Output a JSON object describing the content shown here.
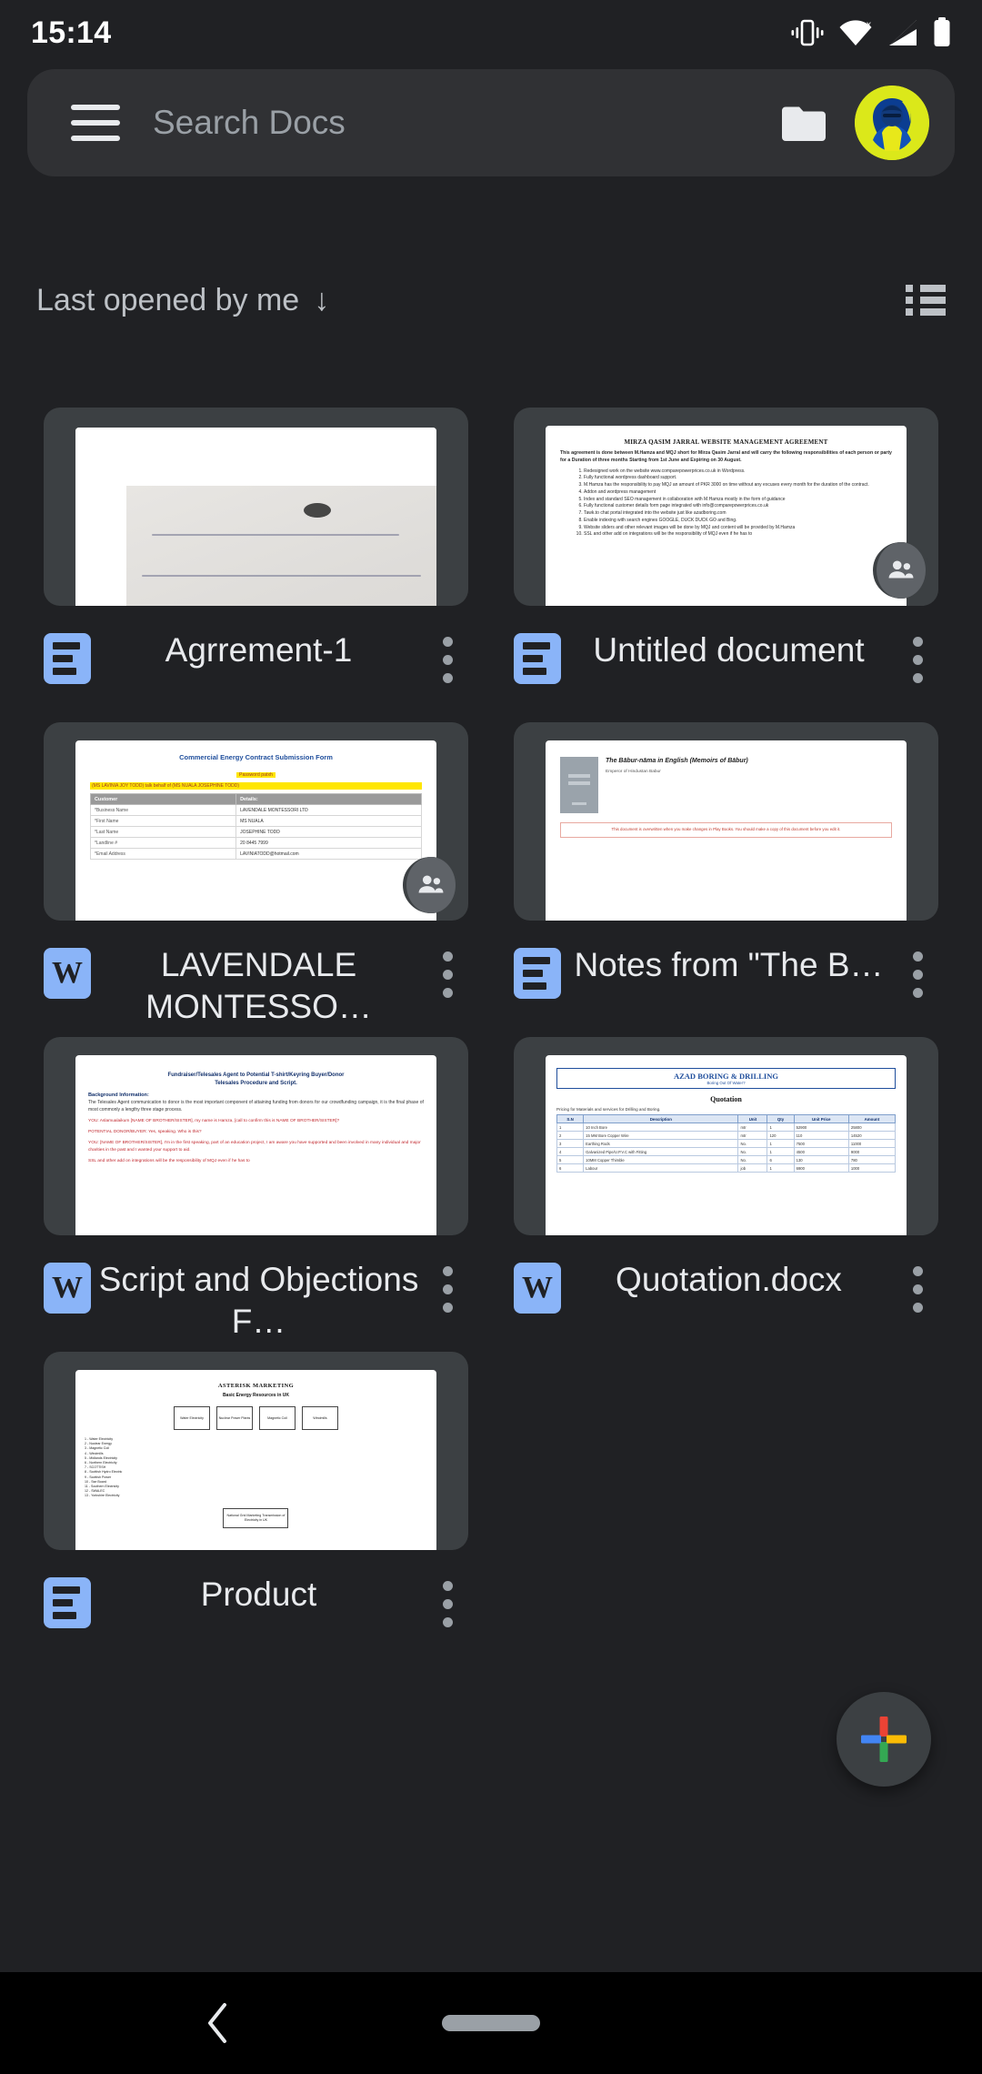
{
  "status_bar": {
    "time": "15:14",
    "icons": [
      "vibrate-icon",
      "wifi-icon",
      "signal-icon",
      "battery-icon"
    ]
  },
  "search": {
    "placeholder": "Search Docs",
    "value": "",
    "menu_icon": "hamburger-menu-icon",
    "folder_icon": "folder-icon",
    "avatar_label": "account-avatar"
  },
  "sort": {
    "label": "Last opened by me",
    "arrow": "↓",
    "view_toggle_icon": "list-view-icon"
  },
  "colors": {
    "background": "#202124",
    "surface": "#303134",
    "thumb_bg": "#3c4043",
    "docs_blue": "#8ab4f8",
    "text_primary": "#e8eaed",
    "text_secondary": "#9aa0a6"
  },
  "fab": {
    "label": "create-new-document",
    "icon": "google-plus-icon"
  },
  "nav": {
    "back_icon": "back-chevron-icon",
    "home_pill": "home-gesture-pill"
  },
  "documents": [
    {
      "title": "Agrrement-1",
      "type_icon": "google-docs-icon",
      "type": "docs",
      "shared": false,
      "thumbnail": {
        "kind": "handwriting-scan",
        "description": "Scanned handwritten Urdu letter on white page"
      }
    },
    {
      "title": "Untitled document",
      "type_icon": "google-docs-icon",
      "type": "docs",
      "shared": true,
      "thumbnail": {
        "kind": "text-document",
        "heading": "MIRZA QASIM JARRAL WEBSITE  MANAGEMENT AGREEMENT",
        "intro": "This agreement is done between M.Hamza and MQJ short for Mirza Qasim Jarral and will carry the following responsibilities of each person or party for a Duration of three months Starting from 1st June and Expiring on 30 August.",
        "items": [
          "Redesigned work on the website www.comparepowerprices.co.uk in Wordpress.",
          "Fully functional wordpress dashboard support.",
          "M.Hamza has the responsibility to pay MQJ an amount of PKR 3000 on time without any excuses every month for the duration of the contract.",
          "Addon and wordpress management",
          "Index and standard SEO management  in collaboration with M.Hamza mostly in the form of guidance",
          "Fully functional customer details form page integrated with info@comparepowerprices.co.uk",
          "Tawk.to chat portal integrated into the website just like azadboring.com",
          "Enable indexing with search engines GOOGLE, DUCK DUCK GO and Bing.",
          "Website sliders and other relevant images will be done by MQJ and content will be provided by M.Hamza",
          "SSL and other add on integrations will be the responsibility of MQJ even if he has to"
        ]
      }
    },
    {
      "title": "LAVENDALE MONTESSO…",
      "type_icon": "word-doc-icon",
      "type": "word",
      "shared": true,
      "thumbnail": {
        "kind": "form-table",
        "heading": "Commercial Energy Contract Submission Form",
        "highlight_1": "Password     patxh",
        "highlight_2": "(MS LAVINIA JOY TODD) talk behalf of (MS NUALA JOSEPHINE TODD)",
        "columns": [
          "Customer",
          "Details:"
        ],
        "rows": [
          [
            "*Business Name",
            "LAVENDALE MONTESSORI LTD"
          ],
          [
            "*First Name",
            "MS NUALA"
          ],
          [
            "*Last Name",
            "JOSEPHINE TODD"
          ],
          [
            "*Landline #",
            "20 8445 7999"
          ],
          [
            "*Email Address",
            "LAVINIATODD@hotmail.com"
          ]
        ]
      }
    },
    {
      "title": "Notes from \"The B…",
      "type_icon": "google-docs-icon",
      "type": "docs",
      "shared": false,
      "thumbnail": {
        "kind": "book-notes",
        "heading": "The Bābur-nāma in English (Memoirs of Bābur)",
        "subheading": "Emperor of Hindustan Babur",
        "warning": "This document is overwritten when you make changes in Play Books. You should make a copy of this document before you edit it."
      }
    },
    {
      "title": "Script and Objections F…",
      "type_icon": "word-doc-icon",
      "type": "word",
      "shared": false,
      "thumbnail": {
        "kind": "script-document",
        "heading_1": "Fundraiser/Telesales Agent to Potential T-shirt/Keyring Buyer/Donor",
        "heading_2": "Telesales Procedure and Script.",
        "section": "Background Information:",
        "body": "The Telesales Agent communication to donor is the most important component of attaining funding from donors for our crowdfunding campaign, it is the final phase of most commonly a lengthy three stage process.",
        "red_1": "YOU: Aslamualaikum [NAME OF BROTHER/SISTER], my name is Hamza, [call to confirm this is NAME OF BROTHER/SISTER]?",
        "red_2": "POTENTIAL DONOR/BUYER: Yes, speaking. Who is this?",
        "red_3": "YOU: [NAME OF BROTHER/SISTER], I'm in the first speaking, part of an education project, I am aware you have supported and been involved in many individual and major charities in the past and I wanted your support to aid.",
        "red_4": "SSL and other add on integrations will be the responsibility of MQJ even if he has to"
      }
    },
    {
      "title": "Quotation.docx",
      "type_icon": "word-doc-icon",
      "type": "word",
      "shared": false,
      "thumbnail": {
        "kind": "quotation-document",
        "company": "AZAD BORING & DRILLING",
        "tagline": "Boring Out Of Water?",
        "heading": "Quotation",
        "subtext": "Pricing for Materials and services for Drilling and Boring.",
        "columns": [
          "S.N",
          "Description",
          "Unit",
          "Qty",
          "Unit Price",
          "Amount"
        ],
        "rows": [
          [
            "1",
            "10 Inch Bore",
            "mtr",
            "1",
            "52900",
            "25800"
          ],
          [
            "2",
            "15 MM Bore Copper Wire",
            "mtr",
            "120",
            "110",
            "14520"
          ],
          [
            "3",
            "Earthing Rods",
            "No.",
            "1",
            "7500",
            "11000"
          ],
          [
            "4",
            "Galvanized Pipe/U.P.V.C with Fitting",
            "No.",
            "1",
            "4500",
            "9000"
          ],
          [
            "5",
            "10MM Copper Thimble",
            "No.",
            "6",
            "130",
            "780"
          ],
          [
            "6",
            "Labour",
            "job",
            "1",
            "6900",
            "1000"
          ]
        ]
      }
    },
    {
      "title": "Product",
      "type_icon": "google-docs-icon",
      "type": "docs",
      "shared": false,
      "thumbnail": {
        "kind": "flowchart-document",
        "heading": "ASTERISK MARKETING",
        "subheading": "Basic Energy Resources in UK",
        "boxes": [
          "Water Electricity",
          "Nuclear Power Plants",
          "Magnetic Coil",
          "Windmills"
        ],
        "list": [
          "1 - Water Electricity",
          "2 - Nuclear Energy",
          "3 - Magnetic Coil",
          "4 - Windmills",
          "5 - Midlands Electricity",
          "6 - Northern Electricity",
          "7 - SCOTTISH",
          "8 - Scottish Hydro Electric",
          "9 - Scottish Power",
          "10 - Sse Board",
          "11 - Southern Electricity",
          "12 - SWALEC",
          "13 - Yorkshire Electricity"
        ],
        "footer_box": "National Grid Marketing Transmission of Electricity in UK"
      }
    }
  ]
}
